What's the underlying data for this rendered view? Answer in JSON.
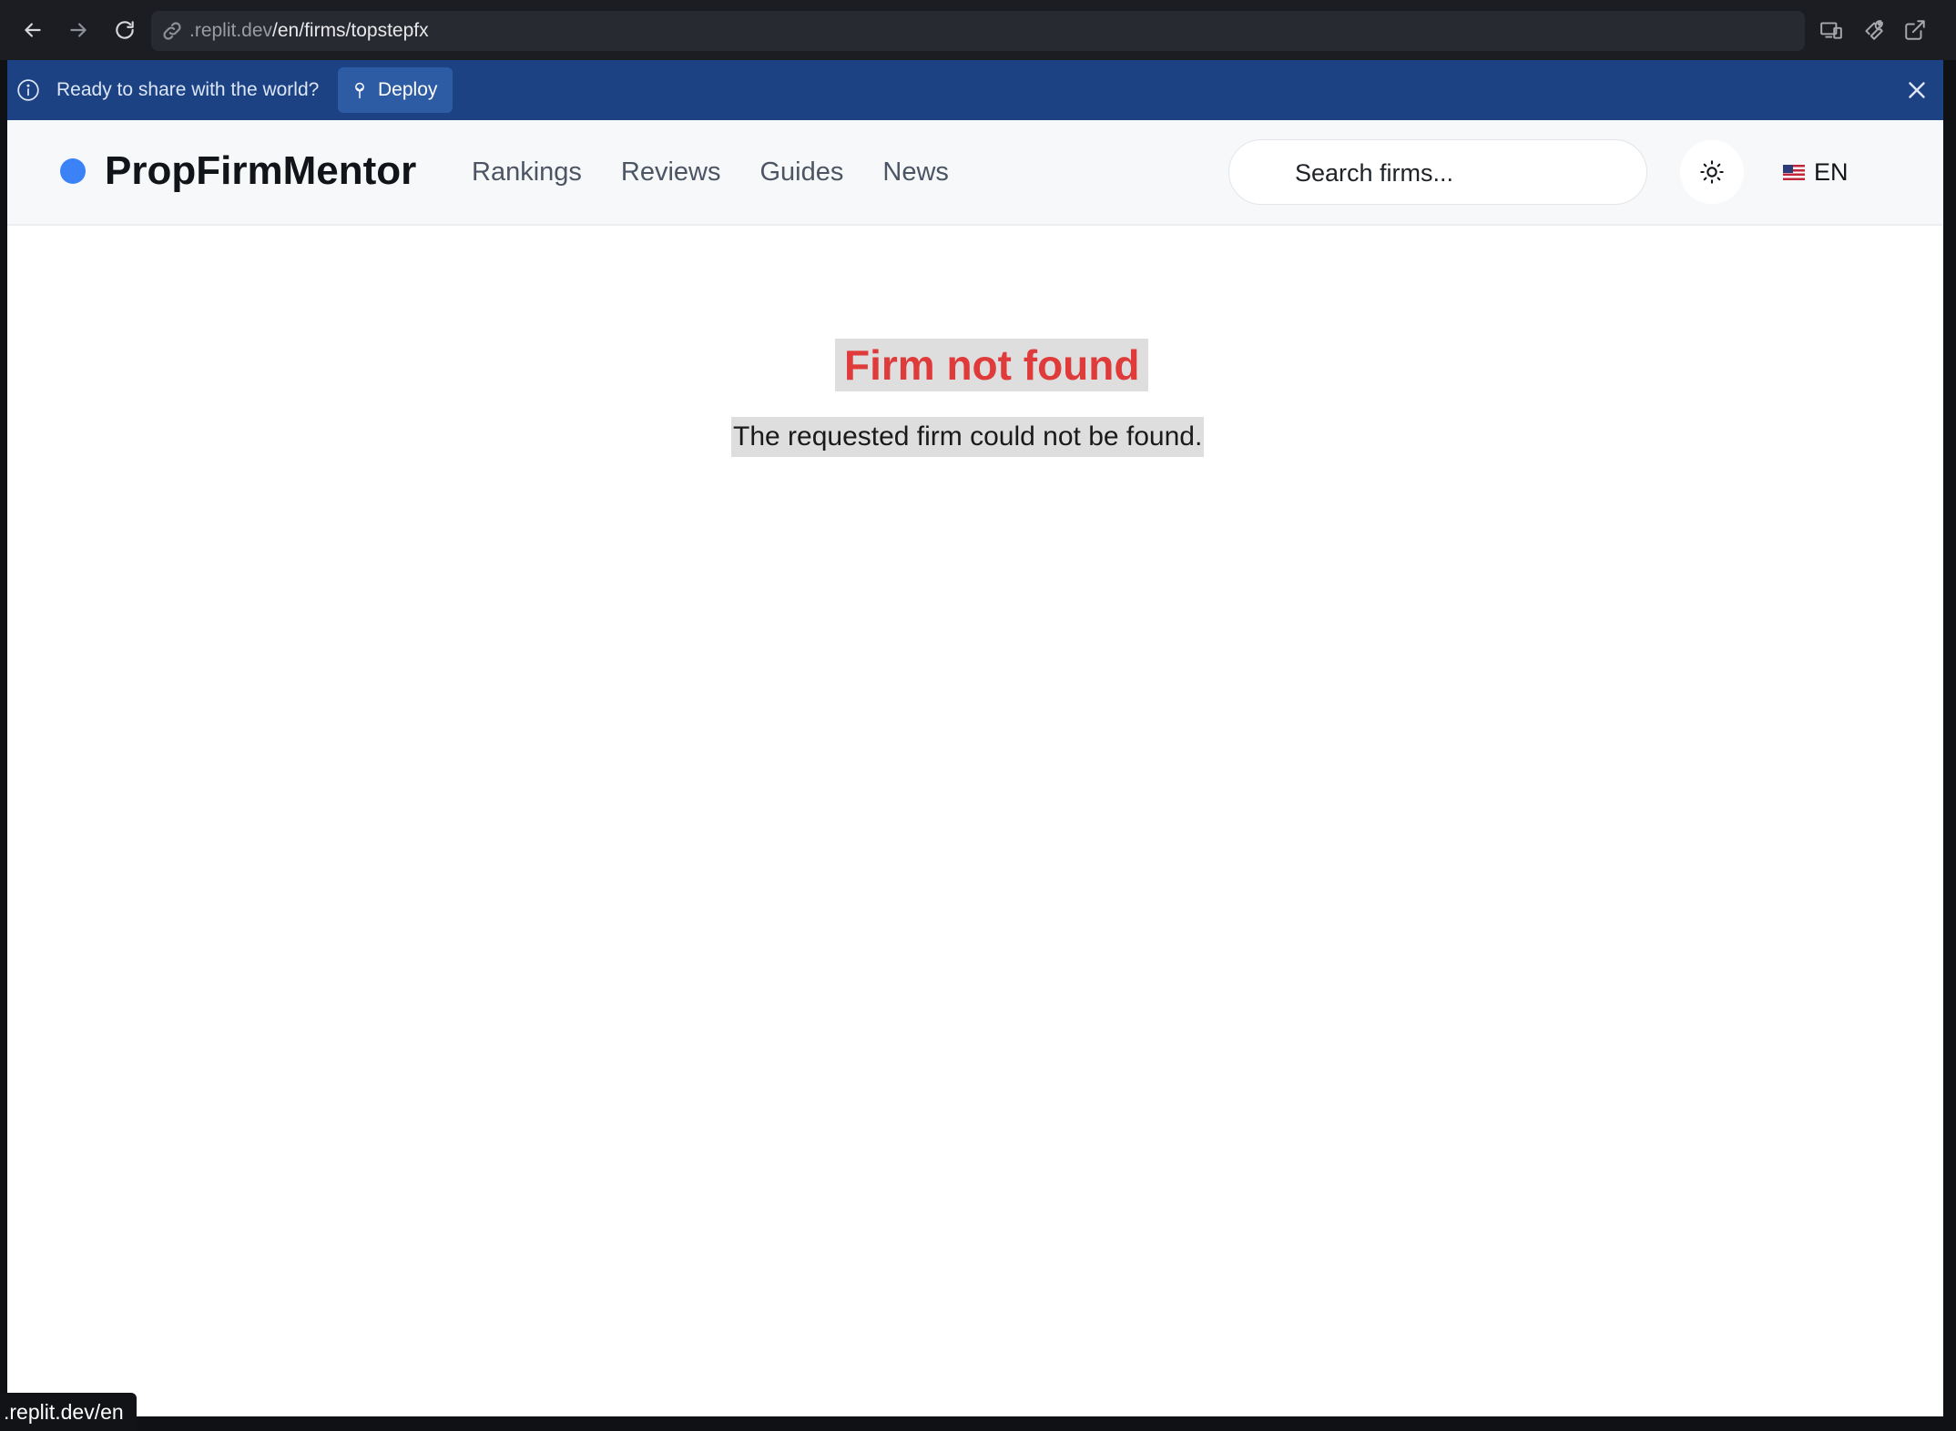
{
  "browser": {
    "url_prefix": ".replit.dev",
    "url_path": "/en/firms/topstepfx",
    "status_url": ".replit.dev/en"
  },
  "banner": {
    "message": "Ready to share with the world?",
    "deploy_label": "Deploy"
  },
  "header": {
    "brand": "PropFirmMentor",
    "nav": [
      "Rankings",
      "Reviews",
      "Guides",
      "News"
    ],
    "search_placeholder": "Search firms...",
    "language": "EN"
  },
  "main": {
    "title": "Firm not found",
    "message": "The requested firm could not be found."
  },
  "colors": {
    "brand_dot": "#3b82f6",
    "error_title": "#df3b3b",
    "banner_bg": "#1c4283",
    "deploy_bg": "#2d5ca5"
  }
}
